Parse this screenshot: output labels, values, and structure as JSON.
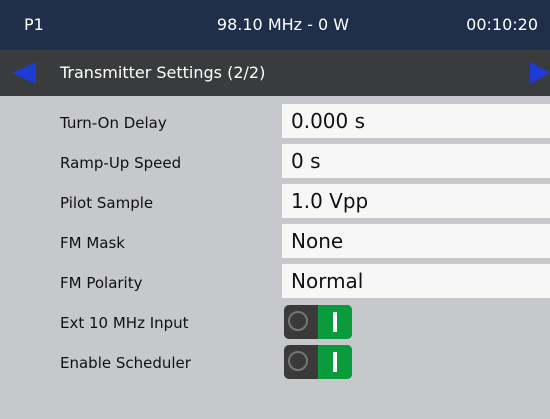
{
  "status": {
    "program": "P1",
    "frequency_power": "98.10 MHz - 0 W",
    "time": "00:10:20"
  },
  "header": {
    "title": "Transmitter Settings (2/2)"
  },
  "settings": [
    {
      "label": "Turn-On Delay",
      "value": "0.000 s"
    },
    {
      "label": "Ramp-Up Speed",
      "value": "0 s"
    },
    {
      "label": "Pilot Sample",
      "value": "1.0 Vpp"
    },
    {
      "label": "FM Mask",
      "value": "None"
    },
    {
      "label": "FM Polarity",
      "value": "Normal"
    }
  ],
  "toggles": [
    {
      "label": "Ext 10 MHz Input",
      "state": "on"
    },
    {
      "label": "Enable Scheduler",
      "state": "on"
    }
  ],
  "colors": {
    "status_bar": "#1f2f49",
    "title_bar": "#3a3b3c",
    "arrow": "#1f3bd6",
    "toggle_on": "#0a9b3c",
    "background": "#c6c8cb"
  }
}
